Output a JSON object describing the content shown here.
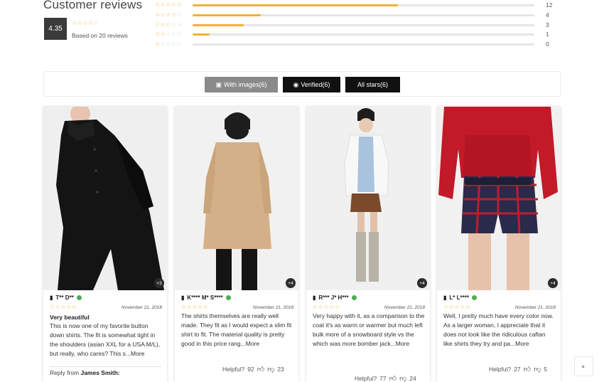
{
  "summary": {
    "title": "Customer reviews",
    "average": "4.35",
    "average_stars": 4,
    "based_on": "Based on 20 reviews",
    "distribution": [
      {
        "stars": 5,
        "count": "12",
        "fraction": 0.6
      },
      {
        "stars": 4,
        "count": "4",
        "fraction": 0.2
      },
      {
        "stars": 3,
        "count": "3",
        "fraction": 0.15
      },
      {
        "stars": 2,
        "count": "1",
        "fraction": 0.05
      },
      {
        "stars": 1,
        "count": "0",
        "fraction": 0.0
      }
    ]
  },
  "filters": {
    "with_images": "With images(6)",
    "verified": "Verified(6)",
    "all_stars": "All stars(6)"
  },
  "reviews": [
    {
      "name": "T** D**",
      "date": "November 21, 2018",
      "stars": 5,
      "title": "Very beautiful",
      "text": "This is now one of my favorite button down shirts. The fit is somewhat tight in the shoulders (asian XXL for a USA M/L), but really, who cares? This s...",
      "more": "More",
      "image_badge": "+3",
      "helpful_label": "",
      "helpful_up": "",
      "helpful_down": "",
      "reply_prefix": "Reply from",
      "reply_author": "James Smith:"
    },
    {
      "name": "K**** M* S****",
      "date": "November 21, 2018",
      "stars": 5,
      "title": "",
      "text": "The shirts themselves are really well made. They fit as I would expect a slim fit shirt to fit. The material quality is pretty good in this price rang...",
      "more": "More",
      "image_badge": "+4",
      "helpful_label": "Helpful?",
      "helpful_up": "92",
      "helpful_down": "23"
    },
    {
      "name": "R*** J* H***",
      "date": "November 21, 2018",
      "stars": 5,
      "title": "",
      "text": "Very happy with it, as a comparison to the coat it's as warm or warmer but much left bulk more of a snowboard style vs the which was more bomber jack...",
      "more": "More",
      "image_badge": "+4",
      "helpful_label": "Helpful?",
      "helpful_up": "77",
      "helpful_down": "24"
    },
    {
      "name": "L* L****",
      "date": "November 21, 2018",
      "stars": 5,
      "title": "",
      "text": "Well, I pretty much have every color now. As a larger woman, I appreciate that it does not look like the ridiculous caftan like shirts they try and pa...",
      "more": "More",
      "image_badge": "+4",
      "helpful_label": "Helpful?",
      "helpful_up": "27",
      "helpful_down": "5"
    }
  ],
  "icons": {
    "camera": "camera-icon",
    "verified": "verified-badge-icon",
    "chat": "comment-icon",
    "thumb_up": "thumbs-up-icon",
    "thumb_down": "thumbs-down-icon",
    "scroll_top": "chevron-up-icon"
  },
  "colors": {
    "star": "#f0b32d",
    "verified": "#4caf50",
    "dark_button": "#111111",
    "grey_button": "#8a8a8a"
  },
  "scroll_top_label": "«"
}
